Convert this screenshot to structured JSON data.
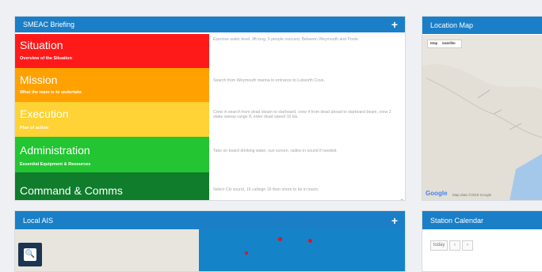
{
  "briefing": {
    "title": "SMEAC Briefing",
    "plus_label": "+",
    "rows": [
      {
        "heading": "Situation",
        "subheading": "Overview of the Situation",
        "description": "Exercise water level, 9ft long, 5 people rescued, Between Weymouth and Poole.",
        "color": "#ff1a1a"
      },
      {
        "heading": "Mission",
        "subheading": "What the team is to undertake",
        "description": "Search from Weymouth marina to entrance to Lulworth Cove.",
        "color": "#ffa100"
      },
      {
        "heading": "Execution",
        "subheading": "Plan of action",
        "description": "Crew in search from dead steam to starboard, crew 4 from dead ahead to starboard beam, crew 2 stake sweep range 8, enter dead speed 10 kts.",
        "color": "#ffd235"
      },
      {
        "heading": "Administration",
        "subheading": "Essential Equipment & Resources",
        "description": "Take on board drinking water, sun screen, radios in sound if needed.",
        "color": "#23c532"
      },
      {
        "heading": "Command & Comms",
        "subheading": "",
        "description": "Select CH sound, 16 callsign 16 then shore to be in touch.",
        "color": "#0f7d2c"
      }
    ]
  },
  "location_map": {
    "title": "Location Map",
    "toggle": [
      "Map",
      "Satellite"
    ],
    "google": "Google",
    "attribution": "Map data ©2018 Google"
  },
  "local_ais": {
    "title": "Local AIS",
    "plus_label": "+",
    "zoom_icon": "magnifier-icon"
  },
  "station_calendar": {
    "title": "Station Calendar",
    "controls": [
      "today",
      "‹",
      "›"
    ]
  },
  "colors": {
    "header": "#1a7fc7",
    "sea": "#1483c8",
    "ais_pin": "#e1131f"
  }
}
